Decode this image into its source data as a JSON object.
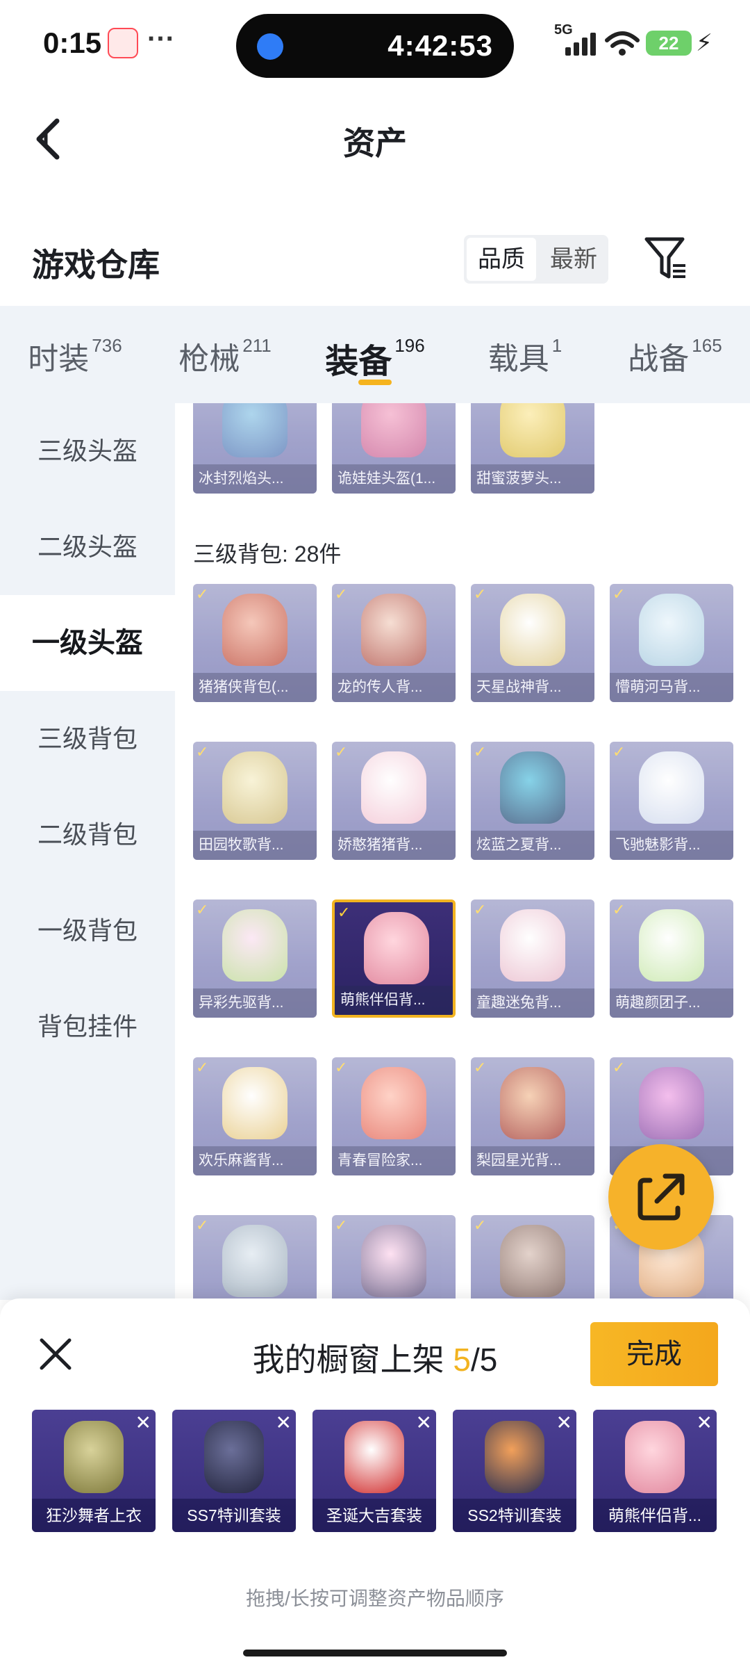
{
  "status_bar": {
    "time": "0:15",
    "app_badge": "618",
    "dots": "···",
    "timer": "4:42:53",
    "network": "5G",
    "battery": "22"
  },
  "header": {
    "title": "资产"
  },
  "section": {
    "title": "游戏仓库",
    "sort_quality": "品质",
    "sort_newest": "最新"
  },
  "tabs": [
    {
      "label": "时装",
      "count": "736"
    },
    {
      "label": "枪械",
      "count": "211"
    },
    {
      "label": "装备",
      "count": "196"
    },
    {
      "label": "载具",
      "count": "1"
    },
    {
      "label": "战备",
      "count": "165"
    }
  ],
  "sidebar": [
    {
      "label": "三级头盔"
    },
    {
      "label": "二级头盔"
    },
    {
      "label": "一级头盔"
    },
    {
      "label": "三级背包"
    },
    {
      "label": "二级背包"
    },
    {
      "label": "一级背包"
    },
    {
      "label": "背包挂件"
    }
  ],
  "grid": {
    "helmets_row": [
      "冰封烈焰头...",
      "诡娃娃头盔(1...",
      "甜蜜菠萝头..."
    ],
    "backpack_group_title": "三级背包: 28件",
    "backpacks": [
      "猪猪侠背包(...",
      "龙的传人背...",
      "天星战神背...",
      "懵萌河马背...",
      "田园牧歌背...",
      "娇憨猪猪背...",
      "炫蓝之夏背...",
      "飞驰魅影背...",
      "异彩先驱背...",
      "萌熊伴侣背...",
      "童趣迷兔背...",
      "萌趣颜团子...",
      "欢乐麻酱背...",
      "青春冒险家...",
      "梨园星光背...",
      ""
    ]
  },
  "panel": {
    "title_prefix": "我的橱窗上架 ",
    "current": "5",
    "total": "/5",
    "done_label": "完成",
    "items": [
      "狂沙舞者上衣",
      "SS7特训套装",
      "圣诞大吉套装",
      "SS2特训套装",
      "萌熊伴侣背..."
    ],
    "hint": "拖拽/长按可调整资产物品顺序"
  },
  "colors": {
    "accent": "#f5b31f",
    "card_purple": "#7d7fb8",
    "sidebar_bg": "#eff3f8"
  }
}
